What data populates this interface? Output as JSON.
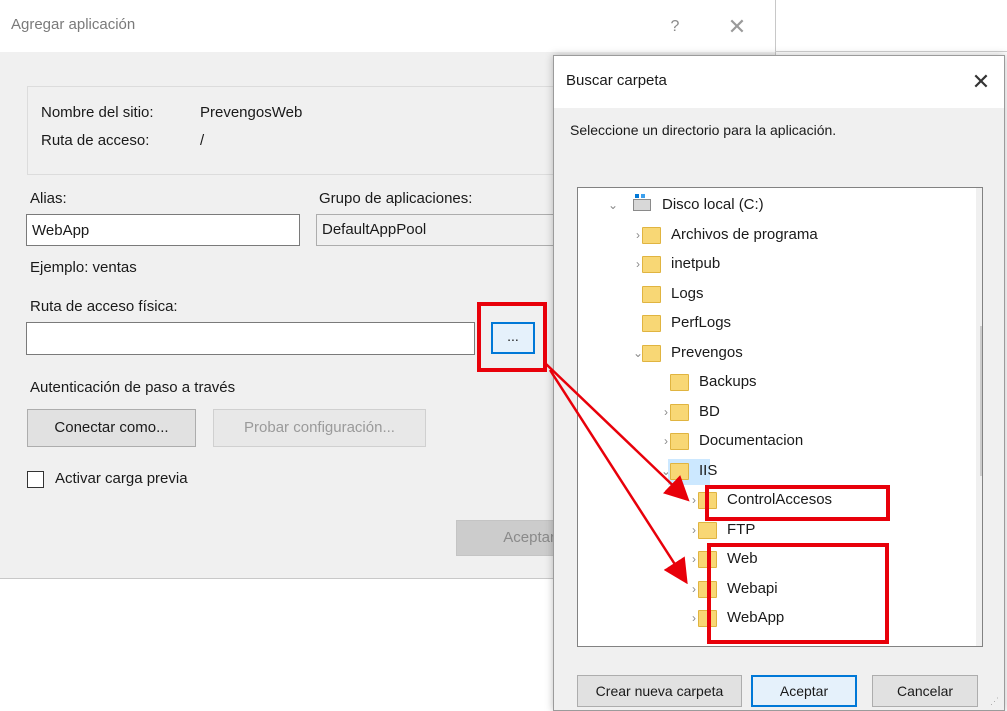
{
  "add_app_dialog": {
    "title": "Agregar aplicación",
    "help_glyph": "?",
    "close_glyph": "✕",
    "site_name_label": "Nombre del sitio:",
    "site_name_value": "PrevengosWeb",
    "path_label": "Ruta de acceso:",
    "path_value": "/",
    "alias_label": "Alias:",
    "alias_value": "WebApp",
    "pool_label": "Grupo de aplicaciones:",
    "pool_value": "DefaultAppPool",
    "example_text": "Ejemplo: ventas",
    "physical_path_label": "Ruta de acceso física:",
    "physical_path_value": "",
    "browse_label": "...",
    "auth_label": "Autenticación de paso a través",
    "connect_as_label": "Conectar como...",
    "test_settings_label": "Probar configuración...",
    "preload_label": "Activar carga previa",
    "preload_checked": false,
    "accept_label": "Aceptar"
  },
  "browse_folder_dialog": {
    "title": "Buscar carpeta",
    "close_glyph": "✕",
    "description": "Seleccione un directorio para la aplicación.",
    "tree": [
      {
        "label": "Disco local (C:)",
        "chevron": "⌄",
        "icon": "drive-icon"
      },
      {
        "label": "Archivos de programa",
        "chevron": "›",
        "icon": "folder-icon"
      },
      {
        "label": "inetpub",
        "chevron": "›",
        "icon": "folder-icon"
      },
      {
        "label": "Logs",
        "chevron": "",
        "icon": "folder-icon"
      },
      {
        "label": "PerfLogs",
        "chevron": "",
        "icon": "folder-icon"
      },
      {
        "label": "Prevengos",
        "chevron": "⌄",
        "icon": "folder-icon"
      },
      {
        "label": "Backups",
        "chevron": "",
        "icon": "folder-icon"
      },
      {
        "label": "BD",
        "chevron": "›",
        "icon": "folder-icon"
      },
      {
        "label": "Documentacion",
        "chevron": "›",
        "icon": "folder-icon"
      },
      {
        "label": "IIS",
        "chevron": "⌄",
        "icon": "folder-icon",
        "selected": true
      },
      {
        "label": "ControlAccesos",
        "chevron": "›",
        "icon": "folder-icon"
      },
      {
        "label": "FTP",
        "chevron": "›",
        "icon": "folder-icon"
      },
      {
        "label": "Web",
        "chevron": "›",
        "icon": "folder-icon"
      },
      {
        "label": "Webapi",
        "chevron": "›",
        "icon": "folder-icon"
      },
      {
        "label": "WebApp",
        "chevron": "›",
        "icon": "folder-icon"
      }
    ],
    "scroll_up_glyph": "⌃",
    "scroll_down_glyph": "⌄",
    "new_folder_label": "Crear nueva carpeta",
    "accept_label": "Aceptar",
    "cancel_label": "Cancelar"
  },
  "colors": {
    "annotation_red": "#e8000a",
    "selection_blue": "#cce8ff",
    "focus_blue": "#0078d7",
    "folder_yellow": "#f8d775"
  }
}
